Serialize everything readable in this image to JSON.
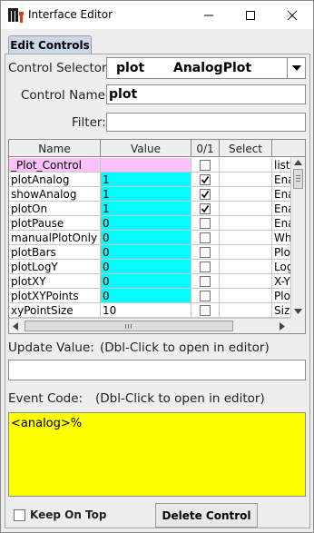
{
  "window": {
    "title": "Interface Editor"
  },
  "tab": {
    "label": "Edit Controls"
  },
  "control_selector": {
    "label": "Control Selector:",
    "value_name": "plot",
    "value_type": "AnalogPlot"
  },
  "control_name": {
    "label": "Control Name:",
    "value": "plot"
  },
  "filter": {
    "label": "Filter:",
    "value": ""
  },
  "table": {
    "columns": [
      "Name",
      "Value",
      "0/1",
      "Select"
    ],
    "rows": [
      {
        "name": "_Plot_Control",
        "value": "",
        "checked": false,
        "select": "",
        "extra": "list",
        "highlight": "pink"
      },
      {
        "name": "plotAnalog",
        "value": "1",
        "checked": true,
        "select": "",
        "extra": "Ena",
        "highlight": "cyan"
      },
      {
        "name": "showAnalog",
        "value": "1",
        "checked": true,
        "select": "",
        "extra": "Ena",
        "highlight": "cyan"
      },
      {
        "name": "plotOn",
        "value": "1",
        "checked": true,
        "select": "",
        "extra": "Ena",
        "highlight": "cyan"
      },
      {
        "name": "plotPause",
        "value": "0",
        "checked": false,
        "select": "",
        "extra": "Ena",
        "highlight": "cyan"
      },
      {
        "name": "manualPlotOnly",
        "value": "0",
        "checked": false,
        "select": "",
        "extra": "Wh",
        "highlight": "cyan"
      },
      {
        "name": "plotBars",
        "value": "0",
        "checked": false,
        "select": "",
        "extra": "Plot",
        "highlight": "cyan"
      },
      {
        "name": "plotLogY",
        "value": "0",
        "checked": false,
        "select": "",
        "extra": "Log",
        "highlight": "cyan"
      },
      {
        "name": "plotXY",
        "value": "0",
        "checked": false,
        "select": "",
        "extra": "X-Y",
        "highlight": "cyan"
      },
      {
        "name": "plotXYPoints",
        "value": "0",
        "checked": false,
        "select": "",
        "extra": "Plot",
        "highlight": "cyan"
      },
      {
        "name": "xyPointSize",
        "value": "10",
        "checked": false,
        "select": "",
        "extra": "Size",
        "highlight": "none"
      }
    ]
  },
  "update_value": {
    "label": "Update Value:",
    "hint": "(Dbl-Click to open in editor)",
    "value": ""
  },
  "event_code": {
    "label": "Event Code:",
    "hint": "(Dbl-Click to open in editor)",
    "value": "<analog>%"
  },
  "keep_on_top": {
    "label": "Keep On Top",
    "checked": false
  },
  "delete_button": {
    "label": "Delete Control"
  },
  "colors": {
    "pink": "#ffc0ff",
    "cyan": "#00ffff",
    "yellow": "#ffff00",
    "tab": "#cbd6e6"
  }
}
